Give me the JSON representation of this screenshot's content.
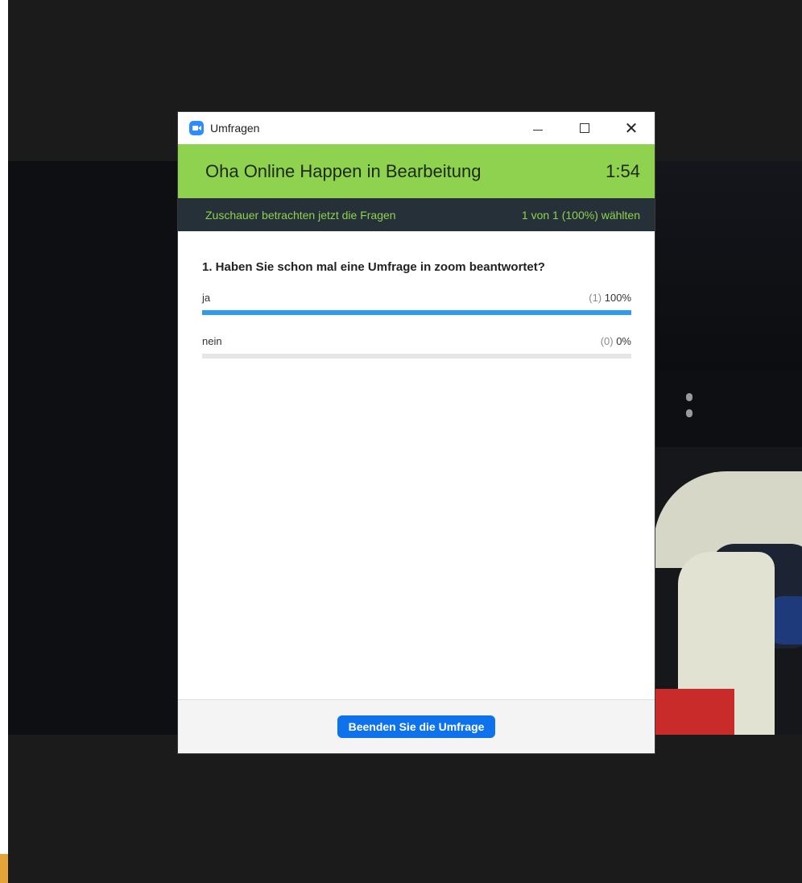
{
  "window": {
    "title": "Umfragen",
    "controls": {
      "minimize": "minimize-icon",
      "maximize": "maximize-icon",
      "close": "close-icon"
    }
  },
  "poll": {
    "title": "Oha Online Happen  in Bearbeitung",
    "timer": "1:54",
    "status_text": "Zuschauer betrachten jetzt die Fragen",
    "votes_text": "1 von 1 (100%) wählten",
    "question": "1. Haben Sie schon mal eine Umfrage in zoom beantwortet?",
    "answers": [
      {
        "label": "ja",
        "count": "(1)",
        "percent": "100%",
        "fraction": 1.0
      },
      {
        "label": "nein",
        "count": "(0)",
        "percent": "0%",
        "fraction": 0.0
      }
    ]
  },
  "footer": {
    "end_button": "Beenden Sie die Umfrage"
  },
  "colors": {
    "header_green": "#8fd24f",
    "status_bg": "#253039",
    "bar_blue": "#2d9bf0",
    "button_blue": "#0e72ed"
  }
}
